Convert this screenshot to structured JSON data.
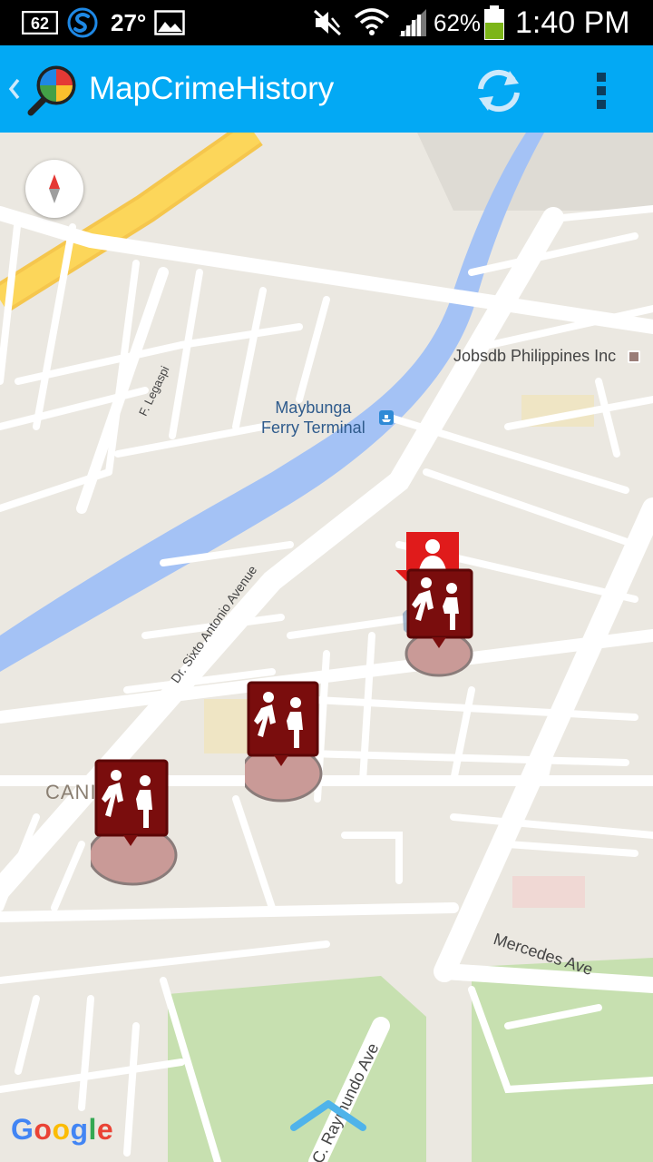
{
  "status_bar": {
    "notification_badge": "62",
    "temperature": "27°",
    "battery_percent": "62%",
    "time": "1:40 PM",
    "icons": [
      "notification-count-icon",
      "s-app-icon",
      "image-icon",
      "mute-icon",
      "wifi-icon",
      "signal-icon",
      "battery-icon"
    ]
  },
  "app_bar": {
    "title": "MapCrimeHistory",
    "color": "#03a9f4",
    "icons": [
      "back-chevron-icon",
      "app-logo-icon",
      "refresh-icon",
      "overflow-menu-icon"
    ]
  },
  "map": {
    "labels": {
      "business": "Jobsdb Philippines Inc",
      "terminal_line1": "Maybunga",
      "terminal_line2": "Ferry Terminal",
      "street_legaspi": "F. Legaspi",
      "street_sixto": "Dr. Sixto Antonio Avenue",
      "area": "CANI",
      "street_mercedes": "Mercedes Ave",
      "street_raymundo": "C. Raymundo Ave"
    },
    "markers": [
      {
        "type": "person-report",
        "icon": "person-marker-icon",
        "color": "#e01b1b"
      },
      {
        "type": "assault",
        "icon": "assault-marker-icon",
        "color": "#7a0d0d"
      },
      {
        "type": "assault",
        "icon": "assault-marker-icon",
        "color": "#7a0d0d"
      },
      {
        "type": "assault",
        "icon": "assault-marker-icon",
        "color": "#7a0d0d"
      }
    ],
    "attribution": "Google",
    "water_color": "#a4c2f5",
    "highway_color": "#fcd65a",
    "park_color": "#c7e0b0"
  }
}
